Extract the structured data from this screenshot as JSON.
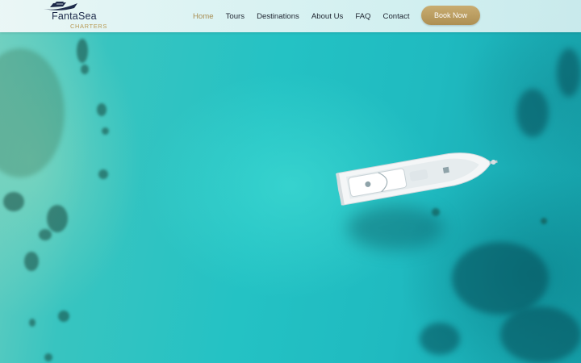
{
  "brand": {
    "name": "FantaSea",
    "tagline": "CHARTERS",
    "accent_color": "#b89a55",
    "icon": "yacht-logo-icon"
  },
  "nav": {
    "items": [
      {
        "label": "Home",
        "active": true
      },
      {
        "label": "Tours",
        "active": false
      },
      {
        "label": "Destinations",
        "active": false
      },
      {
        "label": "About Us",
        "active": false
      },
      {
        "label": "FAQ",
        "active": false
      },
      {
        "label": "Contact",
        "active": false
      }
    ],
    "active_color": "#a88d52"
  },
  "cta": {
    "label": "Book Now",
    "color": "#b89a55"
  },
  "hero": {
    "image": "aerial-yacht-turquoise-sea",
    "sea_color": "#24c2c4"
  }
}
